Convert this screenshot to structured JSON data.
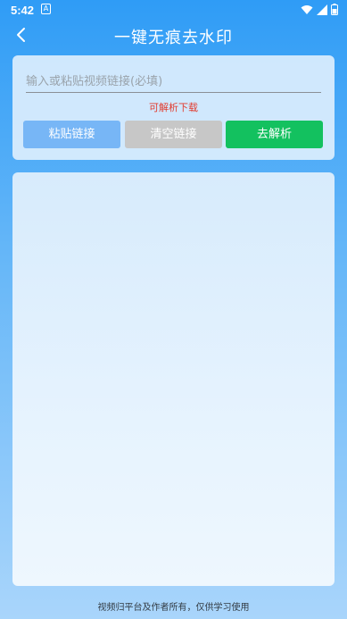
{
  "status_bar": {
    "time": "5:42",
    "notification_glyph": "A",
    "icons": [
      "wifi-icon",
      "signal-icon",
      "battery-icon"
    ]
  },
  "app_bar": {
    "title": "一键无痕去水印",
    "back_icon": "chevron-left-icon"
  },
  "input_card": {
    "url_placeholder": "输入或粘贴视频链接(必填)",
    "url_value": "",
    "hint": "可解析下载",
    "buttons": {
      "paste": "粘贴链接",
      "clear": "清空链接",
      "parse": "去解析"
    }
  },
  "footer": {
    "note": "视频归平台及作者所有，仅供学习使用"
  },
  "colors": {
    "paste_button": "#77b6f6",
    "clear_button": "#c7c7c7",
    "parse_button": "#13c15f",
    "hint_text": "#e23b2e"
  }
}
